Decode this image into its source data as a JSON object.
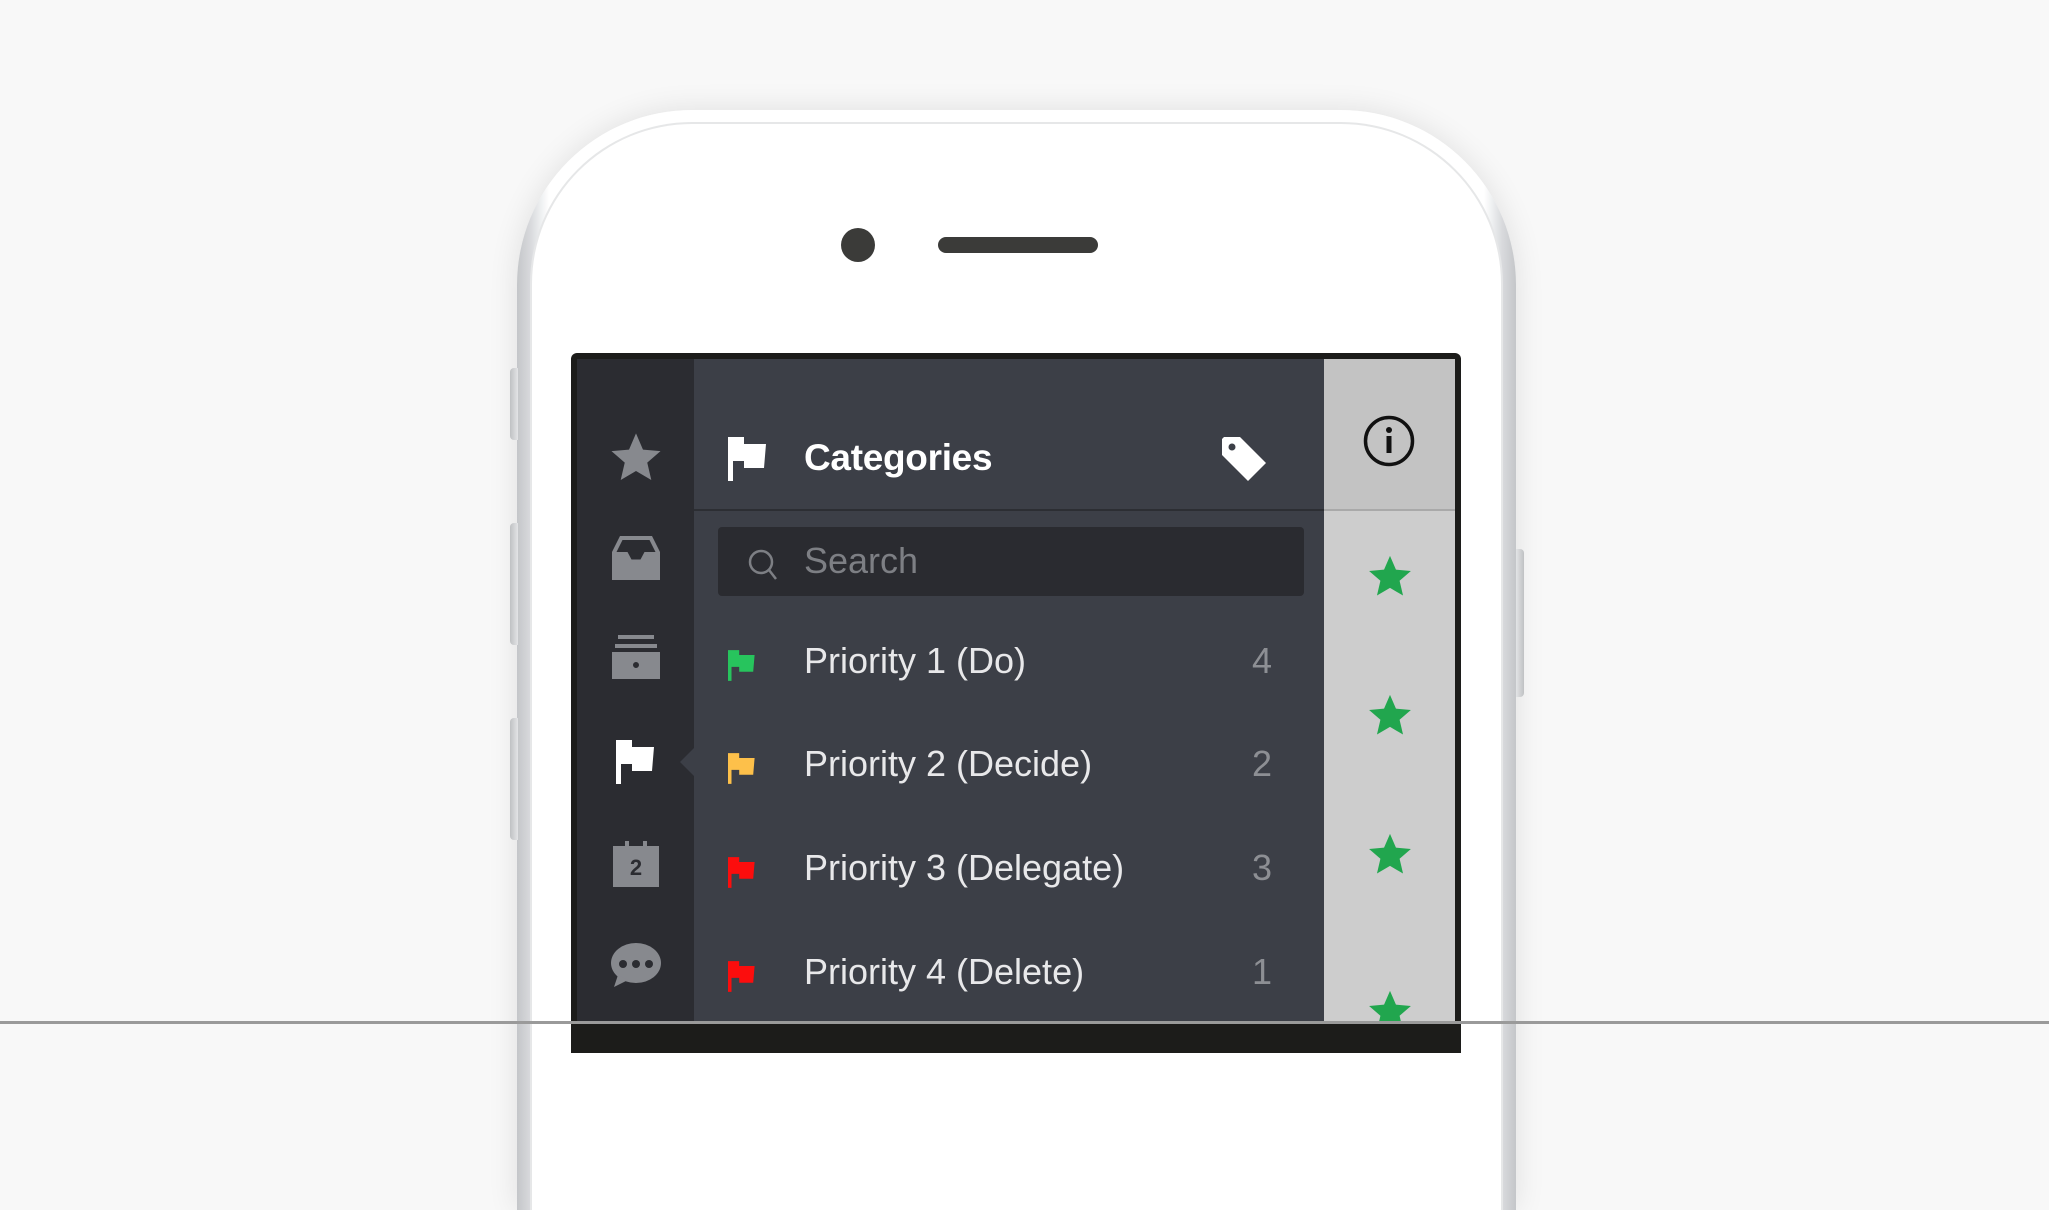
{
  "sidebar": {
    "items": [
      {
        "icon": "star-icon",
        "label": "Starred",
        "active": false
      },
      {
        "icon": "inbox-icon",
        "label": "Inbox",
        "active": false
      },
      {
        "icon": "archive-icon",
        "label": "Archive",
        "active": false
      },
      {
        "icon": "flag-icon",
        "label": "Categories",
        "active": true
      },
      {
        "icon": "calendar-icon",
        "label": "Calendar",
        "badge": "2",
        "active": false
      },
      {
        "icon": "chat-icon",
        "label": "Messages",
        "active": false
      }
    ],
    "icon_color": "#87898e",
    "active_color": "#ffffff"
  },
  "panel": {
    "header": {
      "icon": "flag-icon",
      "title": "Categories",
      "action_icon": "tag-icon"
    },
    "search": {
      "placeholder": "Search",
      "value": ""
    },
    "categories": [
      {
        "label": "Priority 1 (Do)",
        "count": "4",
        "flag_color": "#27c45d"
      },
      {
        "label": "Priority 2 (Decide)",
        "count": "2",
        "flag_color": "#fdc04a"
      },
      {
        "label": "Priority 3 (Delegate)",
        "count": "3",
        "flag_color": "#fc0d0d"
      },
      {
        "label": "Priority 4 (Delete)",
        "count": "1",
        "flag_color": "#fc0d0d"
      }
    ]
  },
  "right_column": {
    "header_icon": "info-icon",
    "rows": [
      {
        "icon": "star-icon",
        "color": "#21a64e"
      },
      {
        "icon": "star-icon",
        "color": "#21a64e"
      },
      {
        "icon": "star-icon",
        "color": "#21a64e"
      },
      {
        "icon": "star-icon",
        "color": "#21a64e"
      }
    ]
  }
}
